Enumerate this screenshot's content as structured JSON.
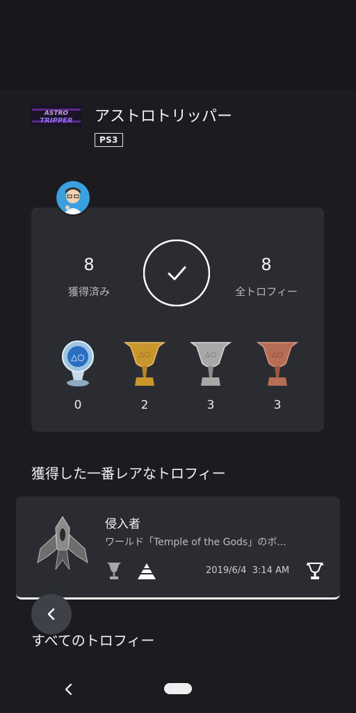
{
  "game": {
    "title": "アストロトリッパー",
    "platform": "PS3",
    "logo_text_top": "ASTRO",
    "logo_text_bottom": "TRIPPER"
  },
  "summary": {
    "earned_count": "8",
    "earned_label": "獲得済み",
    "total_count": "8",
    "total_label": "全トロフィー",
    "completion": 1.0
  },
  "trophy_counts": [
    {
      "type": "platinum",
      "count": "0"
    },
    {
      "type": "gold",
      "count": "2"
    },
    {
      "type": "silver",
      "count": "3"
    },
    {
      "type": "bronze",
      "count": "3"
    }
  ],
  "rarest": {
    "section_title": "獲得した一番レアなトロフィー",
    "name": "侵入者",
    "description": "ワールド「Temple of the Gods」のボ...",
    "date": "2019/6/4",
    "time": "3:14 AM"
  },
  "all_trophies": {
    "section_title": "すべてのトロフィー"
  },
  "colors": {
    "background": "#1b1b20",
    "card": "#2a2c31",
    "platinum": "#9fc4e0",
    "gold": "#c9962e",
    "silver": "#a8a8a8",
    "bronze": "#b56d55"
  },
  "icons": [
    "check-icon",
    "trophy-icon",
    "rarity-pyramid-icon",
    "chevron-left-icon",
    "nav-back-icon"
  ]
}
